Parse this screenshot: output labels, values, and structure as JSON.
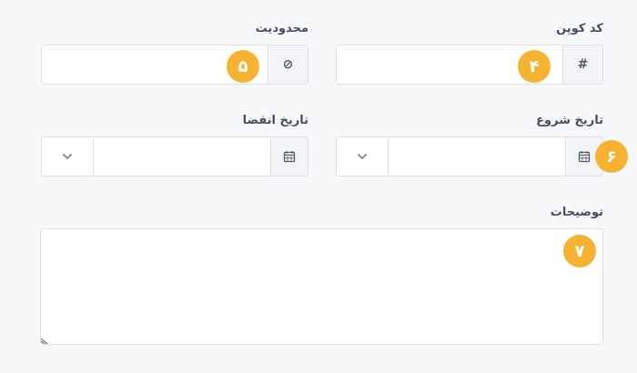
{
  "form": {
    "coupon_code": {
      "label": "کد کوپن",
      "addon_symbol": "#",
      "value": "",
      "badge": "۴"
    },
    "limit": {
      "label": "محدودیت",
      "addon_symbol": "⊘",
      "value": "",
      "badge": "۵"
    },
    "start_date": {
      "label": "تاریخ شروع",
      "value": "",
      "badge": "۶"
    },
    "expiry_date": {
      "label": "تاریخ انقضا",
      "value": ""
    },
    "description": {
      "label": "توضیحات",
      "value": "",
      "badge": "۷"
    }
  },
  "icons": {
    "hash": "hash-icon",
    "ban": "ban-icon",
    "calendar": "calendar-icon",
    "chevron": "chevron-down-icon"
  },
  "colors": {
    "badge": "#f6b332",
    "background": "#f7f8fa",
    "border": "#dcdfe6",
    "addon_bg": "#f3f4f7"
  }
}
